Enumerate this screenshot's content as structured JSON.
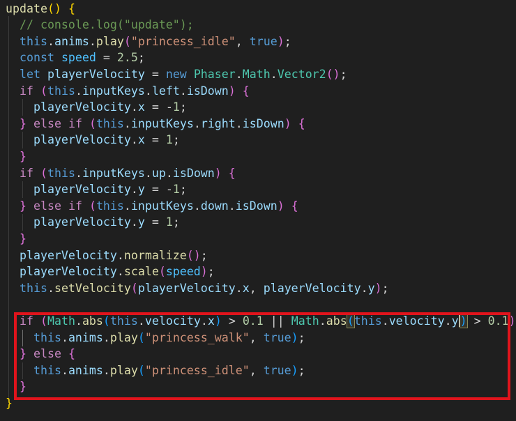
{
  "editor": {
    "language": "javascript",
    "theme_colors": {
      "background": "#1f1f1f",
      "highlight_box": "#e0141c",
      "keyword": "#569cd6",
      "control": "#c586c0",
      "function": "#dcdcaa",
      "variable": "#9cdcfe",
      "string": "#ce9178",
      "number": "#b5cea8",
      "class": "#4ec9b0",
      "comment": "#6a9955",
      "bracket_gold": "#ffd700",
      "bracket_orchid": "#da70d6",
      "bracket_blue": "#179fff"
    },
    "lines": [
      [
        [
          "fn",
          "update"
        ],
        [
          "p1",
          "()"
        ],
        [
          "op",
          " "
        ],
        [
          "p1",
          "{"
        ]
      ],
      [
        [
          "op",
          "  "
        ],
        [
          "cmt",
          "// console.log(\"update\");"
        ]
      ],
      [
        [
          "op",
          "  "
        ],
        [
          "kw",
          "this"
        ],
        [
          "op",
          "."
        ],
        [
          "var",
          "anims"
        ],
        [
          "op",
          "."
        ],
        [
          "fn",
          "play"
        ],
        [
          "p2",
          "("
        ],
        [
          "str",
          "\"princess_idle\""
        ],
        [
          "op",
          ", "
        ],
        [
          "kw",
          "true"
        ],
        [
          "p2",
          ")"
        ],
        [
          "op",
          ";"
        ]
      ],
      [
        [
          "op",
          "  "
        ],
        [
          "kw",
          "const"
        ],
        [
          "op",
          " "
        ],
        [
          "const",
          "speed"
        ],
        [
          "op",
          " = "
        ],
        [
          "num",
          "2.5"
        ],
        [
          "op",
          ";"
        ]
      ],
      [
        [
          "op",
          "  "
        ],
        [
          "kw",
          "let"
        ],
        [
          "op",
          " "
        ],
        [
          "var",
          "playerVelocity"
        ],
        [
          "op",
          " = "
        ],
        [
          "kw",
          "new"
        ],
        [
          "op",
          " "
        ],
        [
          "cls",
          "Phaser"
        ],
        [
          "op",
          "."
        ],
        [
          "cls",
          "Math"
        ],
        [
          "op",
          "."
        ],
        [
          "cls",
          "Vector2"
        ],
        [
          "p2",
          "()"
        ],
        [
          "op",
          ";"
        ]
      ],
      [
        [
          "op",
          "  "
        ],
        [
          "ctl",
          "if"
        ],
        [
          "op",
          " "
        ],
        [
          "p2",
          "("
        ],
        [
          "kw",
          "this"
        ],
        [
          "op",
          "."
        ],
        [
          "var",
          "inputKeys"
        ],
        [
          "op",
          "."
        ],
        [
          "var",
          "left"
        ],
        [
          "op",
          "."
        ],
        [
          "var",
          "isDown"
        ],
        [
          "p2",
          ")"
        ],
        [
          "op",
          " "
        ],
        [
          "p2",
          "{"
        ]
      ],
      [
        [
          "op",
          "    "
        ],
        [
          "var",
          "playerVelocity"
        ],
        [
          "op",
          "."
        ],
        [
          "var",
          "x"
        ],
        [
          "op",
          " = -"
        ],
        [
          "num",
          "1"
        ],
        [
          "op",
          ";"
        ]
      ],
      [
        [
          "op",
          "  "
        ],
        [
          "p2",
          "}"
        ],
        [
          "op",
          " "
        ],
        [
          "ctl",
          "else"
        ],
        [
          "op",
          " "
        ],
        [
          "ctl",
          "if"
        ],
        [
          "op",
          " "
        ],
        [
          "p2",
          "("
        ],
        [
          "kw",
          "this"
        ],
        [
          "op",
          "."
        ],
        [
          "var",
          "inputKeys"
        ],
        [
          "op",
          "."
        ],
        [
          "var",
          "right"
        ],
        [
          "op",
          "."
        ],
        [
          "var",
          "isDown"
        ],
        [
          "p2",
          ")"
        ],
        [
          "op",
          " "
        ],
        [
          "p2",
          "{"
        ]
      ],
      [
        [
          "op",
          "    "
        ],
        [
          "var",
          "playerVelocity"
        ],
        [
          "op",
          "."
        ],
        [
          "var",
          "x"
        ],
        [
          "op",
          " = "
        ],
        [
          "num",
          "1"
        ],
        [
          "op",
          ";"
        ]
      ],
      [
        [
          "op",
          "  "
        ],
        [
          "p2",
          "}"
        ]
      ],
      [
        [
          "op",
          "  "
        ],
        [
          "ctl",
          "if"
        ],
        [
          "op",
          " "
        ],
        [
          "p2",
          "("
        ],
        [
          "kw",
          "this"
        ],
        [
          "op",
          "."
        ],
        [
          "var",
          "inputKeys"
        ],
        [
          "op",
          "."
        ],
        [
          "var",
          "up"
        ],
        [
          "op",
          "."
        ],
        [
          "var",
          "isDown"
        ],
        [
          "p2",
          ")"
        ],
        [
          "op",
          " "
        ],
        [
          "p2",
          "{"
        ]
      ],
      [
        [
          "op",
          "    "
        ],
        [
          "var",
          "playerVelocity"
        ],
        [
          "op",
          "."
        ],
        [
          "var",
          "y"
        ],
        [
          "op",
          " = -"
        ],
        [
          "num",
          "1"
        ],
        [
          "op",
          ";"
        ]
      ],
      [
        [
          "op",
          "  "
        ],
        [
          "p2",
          "}"
        ],
        [
          "op",
          " "
        ],
        [
          "ctl",
          "else"
        ],
        [
          "op",
          " "
        ],
        [
          "ctl",
          "if"
        ],
        [
          "op",
          " "
        ],
        [
          "p2",
          "("
        ],
        [
          "kw",
          "this"
        ],
        [
          "op",
          "."
        ],
        [
          "var",
          "inputKeys"
        ],
        [
          "op",
          "."
        ],
        [
          "var",
          "down"
        ],
        [
          "op",
          "."
        ],
        [
          "var",
          "isDown"
        ],
        [
          "p2",
          ")"
        ],
        [
          "op",
          " "
        ],
        [
          "p2",
          "{"
        ]
      ],
      [
        [
          "op",
          "    "
        ],
        [
          "var",
          "playerVelocity"
        ],
        [
          "op",
          "."
        ],
        [
          "var",
          "y"
        ],
        [
          "op",
          " = "
        ],
        [
          "num",
          "1"
        ],
        [
          "op",
          ";"
        ]
      ],
      [
        [
          "op",
          "  "
        ],
        [
          "p2",
          "}"
        ]
      ],
      [
        [
          "op",
          "  "
        ],
        [
          "var",
          "playerVelocity"
        ],
        [
          "op",
          "."
        ],
        [
          "fn",
          "normalize"
        ],
        [
          "p2",
          "()"
        ],
        [
          "op",
          ";"
        ]
      ],
      [
        [
          "op",
          "  "
        ],
        [
          "var",
          "playerVelocity"
        ],
        [
          "op",
          "."
        ],
        [
          "fn",
          "scale"
        ],
        [
          "p2",
          "("
        ],
        [
          "const",
          "speed"
        ],
        [
          "p2",
          ")"
        ],
        [
          "op",
          ";"
        ]
      ],
      [
        [
          "op",
          "  "
        ],
        [
          "kw",
          "this"
        ],
        [
          "op",
          "."
        ],
        [
          "fn",
          "setVelocity"
        ],
        [
          "p2",
          "("
        ],
        [
          "var",
          "playerVelocity"
        ],
        [
          "op",
          "."
        ],
        [
          "var",
          "x"
        ],
        [
          "op",
          ", "
        ],
        [
          "var",
          "playerVelocity"
        ],
        [
          "op",
          "."
        ],
        [
          "var",
          "y"
        ],
        [
          "p2",
          ")"
        ],
        [
          "op",
          ";"
        ]
      ],
      [],
      [
        [
          "op",
          "  "
        ],
        [
          "ctl",
          "if"
        ],
        [
          "op",
          " "
        ],
        [
          "p2",
          "("
        ],
        [
          "cls",
          "Math"
        ],
        [
          "op",
          "."
        ],
        [
          "fn",
          "abs"
        ],
        [
          "p3",
          "("
        ],
        [
          "kw",
          "this"
        ],
        [
          "op",
          "."
        ],
        [
          "var",
          "velocity"
        ],
        [
          "op",
          "."
        ],
        [
          "var",
          "x"
        ],
        [
          "p3",
          ")"
        ],
        [
          "op",
          " > "
        ],
        [
          "num",
          "0.1"
        ],
        [
          "op",
          " || "
        ],
        [
          "cls",
          "Math"
        ],
        [
          "op",
          "."
        ],
        [
          "fn",
          "abs"
        ],
        [
          "p3",
          "(",
          "match"
        ],
        [
          "kw",
          "this"
        ],
        [
          "op",
          "."
        ],
        [
          "var",
          "velocity"
        ],
        [
          "op",
          "."
        ],
        [
          "var",
          "y"
        ],
        [
          "cursor",
          ""
        ],
        [
          "p3",
          ")",
          "match"
        ],
        [
          "op",
          " > "
        ],
        [
          "num",
          "0.1"
        ],
        [
          "p2",
          ")"
        ],
        [
          "op",
          " "
        ],
        [
          "p2",
          "{"
        ]
      ],
      [
        [
          "op",
          "    "
        ],
        [
          "kw",
          "this"
        ],
        [
          "op",
          "."
        ],
        [
          "var",
          "anims"
        ],
        [
          "op",
          "."
        ],
        [
          "fn",
          "play"
        ],
        [
          "p3",
          "("
        ],
        [
          "str",
          "\"princess_walk\""
        ],
        [
          "op",
          ", "
        ],
        [
          "kw",
          "true"
        ],
        [
          "p3",
          ")"
        ],
        [
          "op",
          ";"
        ]
      ],
      [
        [
          "op",
          "  "
        ],
        [
          "p2",
          "}"
        ],
        [
          "op",
          " "
        ],
        [
          "ctl",
          "else"
        ],
        [
          "op",
          " "
        ],
        [
          "p2",
          "{"
        ]
      ],
      [
        [
          "op",
          "    "
        ],
        [
          "kw",
          "this"
        ],
        [
          "op",
          "."
        ],
        [
          "var",
          "anims"
        ],
        [
          "op",
          "."
        ],
        [
          "fn",
          "play"
        ],
        [
          "p3",
          "("
        ],
        [
          "str",
          "\"princess_idle\""
        ],
        [
          "op",
          ", "
        ],
        [
          "kw",
          "true"
        ],
        [
          "p3",
          ")"
        ],
        [
          "op",
          ";"
        ]
      ],
      [
        [
          "op",
          "  "
        ],
        [
          "p2",
          "}"
        ]
      ],
      [
        [
          "p1",
          "}"
        ]
      ]
    ]
  }
}
